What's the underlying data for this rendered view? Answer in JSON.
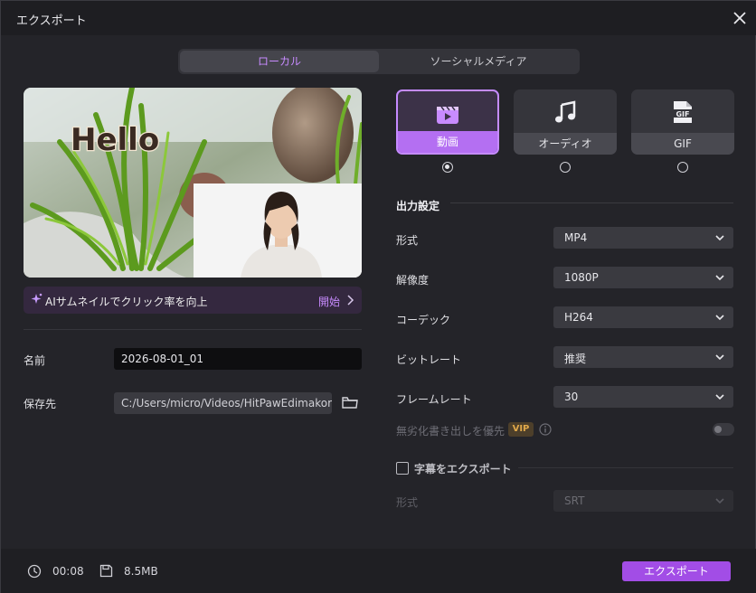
{
  "window": {
    "title": "エクスポート"
  },
  "tabs": [
    {
      "label": "ローカル",
      "active": true
    },
    {
      "label": "ソーシャルメディア",
      "active": false
    }
  ],
  "preview": {
    "overlay_text": "Hello"
  },
  "ai_bar": {
    "text": "AIサムネイルでクリック率を向上",
    "action": "開始"
  },
  "file": {
    "name_label": "名前",
    "name_value": "2026-08-01_01",
    "path_label": "保存先",
    "path_value": "C:/Users/micro/Videos/HitPawEdimakor"
  },
  "export_types": [
    {
      "label": "動画",
      "icon": "video-icon",
      "selected": true
    },
    {
      "label": "オーディオ",
      "icon": "music-note-icon",
      "selected": false
    },
    {
      "label": "GIF",
      "icon": "gif-file-icon",
      "selected": false
    }
  ],
  "output": {
    "title": "出力設定",
    "format_label": "形式",
    "format_value": "MP4",
    "resolution_label": "解像度",
    "resolution_value": "1080P",
    "codec_label": "コーデック",
    "codec_value": "H264",
    "bitrate_label": "ビットレート",
    "bitrate_value": "推奨",
    "framerate_label": "フレームレート",
    "framerate_value": "30",
    "lossless_label": "無劣化書き出しを優先",
    "vip_badge": "VIP",
    "lossless_enabled": false
  },
  "subtitles": {
    "label": "字幕をエクスポート",
    "checked": false,
    "format_label": "形式",
    "format_value": "SRT"
  },
  "footer": {
    "duration": "00:08",
    "size": "8.5MB",
    "export_label": "エクスポート"
  },
  "colors": {
    "accent": "#b46ff2",
    "export_button": "#a24de6",
    "vip_text": "#e0a84a"
  }
}
